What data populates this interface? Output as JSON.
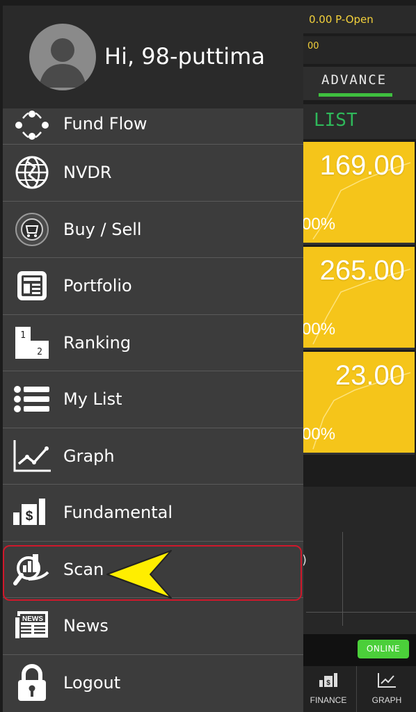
{
  "background": {
    "status_line1": "0.00 P-Open",
    "status_line2": "00",
    "tab_label": "ADVANCE",
    "list_label": "LIST",
    "cards": [
      {
        "price": "169.00",
        "pct": "00%"
      },
      {
        "price": "265.00",
        "pct": "00%"
      },
      {
        "price": "23.00",
        "pct": "00%"
      }
    ],
    "paren": ")",
    "online_badge": "ONLINE",
    "nav": [
      {
        "label": "FINANCE",
        "icon": "finance-icon"
      },
      {
        "label": "GRAPH",
        "icon": "graph-icon"
      }
    ]
  },
  "drawer": {
    "greeting": "Hi, 98-puttima",
    "items": [
      {
        "label": "Fund Flow",
        "icon": "fund-flow-icon"
      },
      {
        "label": "NVDR",
        "icon": "globe-icon"
      },
      {
        "label": "Buy / Sell",
        "icon": "buy-sell-icon"
      },
      {
        "label": "Portfolio",
        "icon": "portfolio-icon"
      },
      {
        "label": "Ranking",
        "icon": "ranking-icon"
      },
      {
        "label": "My List",
        "icon": "list-icon"
      },
      {
        "label": "Graph",
        "icon": "graph-icon"
      },
      {
        "label": "Fundamental",
        "icon": "fundamental-icon"
      },
      {
        "label": "Scan",
        "icon": "scan-icon"
      },
      {
        "label": "News",
        "icon": "news-icon"
      },
      {
        "label": "Logout",
        "icon": "lock-icon"
      }
    ]
  },
  "colors": {
    "drawer_bg": "#3c3c3c",
    "header_bg": "#2a2a2a",
    "card_yellow": "#f5c51a",
    "online_green": "#4bcf3a",
    "highlight_red": "#d0182b",
    "arrow_yellow": "#ffee00"
  }
}
